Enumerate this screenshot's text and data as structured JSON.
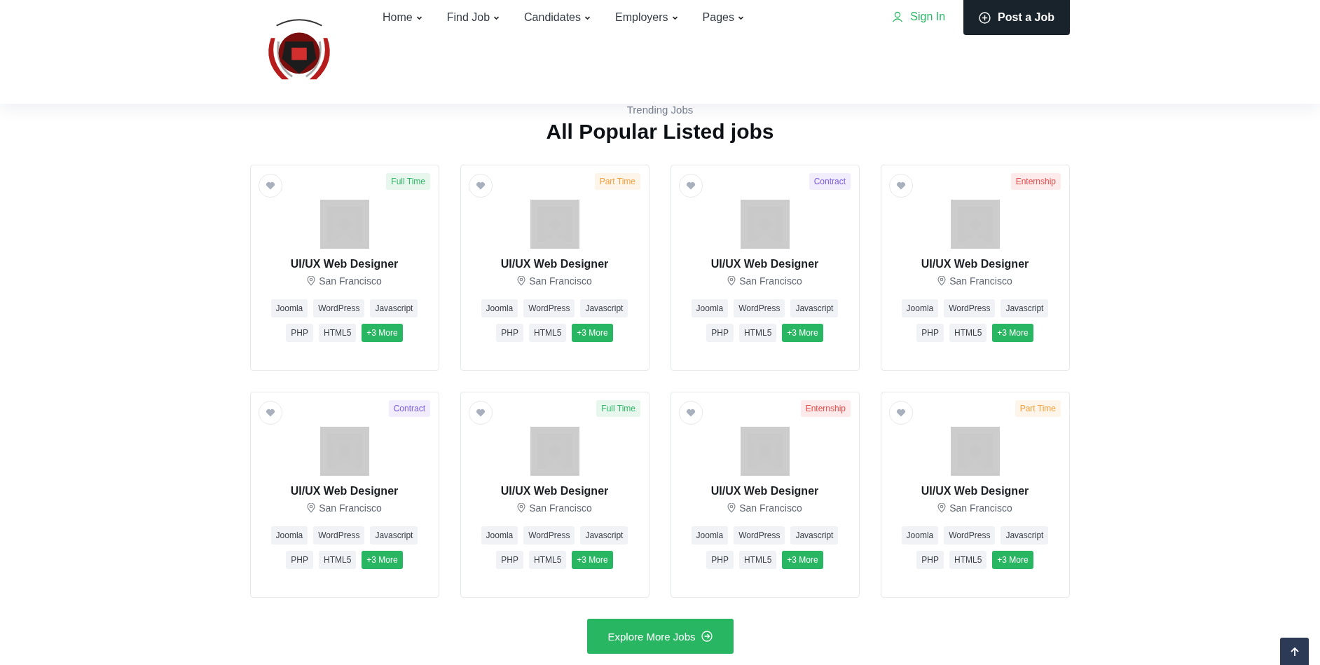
{
  "header": {
    "nav": [
      {
        "label": "Home"
      },
      {
        "label": "Find Job"
      },
      {
        "label": "Candidates"
      },
      {
        "label": "Employers"
      },
      {
        "label": "Pages"
      }
    ],
    "sign_in": "Sign In",
    "post_button": "Post a Job"
  },
  "section": {
    "subtitle": "Trending Jobs",
    "title": "All Popular Listed jobs"
  },
  "jobs": [
    {
      "badge": "Full Time",
      "color": "#2fb866",
      "title": "UI/UX Web Designer",
      "location": "San Francisco",
      "tags": [
        "Joomla",
        "WordPress",
        "Javascript",
        "PHP",
        "HTML5"
      ],
      "more": "+3 More"
    },
    {
      "badge": "Part Time",
      "color": "#f5a03c",
      "title": "UI/UX Web Designer",
      "location": "San Francisco",
      "tags": [
        "Joomla",
        "WordPress",
        "Javascript",
        "PHP",
        "HTML5"
      ],
      "more": "+3 More"
    },
    {
      "badge": "Contract",
      "color": "#7c5ce4",
      "title": "UI/UX Web Designer",
      "location": "San Francisco",
      "tags": [
        "Joomla",
        "WordPress",
        "Javascript",
        "PHP",
        "HTML5"
      ],
      "more": "+3 More"
    },
    {
      "badge": "Enternship",
      "color": "#ea4a4a",
      "title": "UI/UX Web Designer",
      "location": "San Francisco",
      "tags": [
        "Joomla",
        "WordPress",
        "Javascript",
        "PHP",
        "HTML5"
      ],
      "more": "+3 More"
    },
    {
      "badge": "Contract",
      "color": "#7c5ce4",
      "title": "UI/UX Web Designer",
      "location": "San Francisco",
      "tags": [
        "Joomla",
        "WordPress",
        "Javascript",
        "PHP",
        "HTML5"
      ],
      "more": "+3 More"
    },
    {
      "badge": "Full Time",
      "color": "#2fb866",
      "title": "UI/UX Web Designer",
      "location": "San Francisco",
      "tags": [
        "Joomla",
        "WordPress",
        "Javascript",
        "PHP",
        "HTML5"
      ],
      "more": "+3 More"
    },
    {
      "badge": "Enternship",
      "color": "#ea4a4a",
      "title": "UI/UX Web Designer",
      "location": "San Francisco",
      "tags": [
        "Joomla",
        "WordPress",
        "Javascript",
        "PHP",
        "HTML5"
      ],
      "more": "+3 More"
    },
    {
      "badge": "Part Time",
      "color": "#f5a03c",
      "title": "UI/UX Web Designer",
      "location": "San Francisco",
      "tags": [
        "Joomla",
        "WordPress",
        "Javascript",
        "PHP",
        "HTML5"
      ],
      "more": "+3 More"
    }
  ],
  "explore_button": "Explore More Jobs"
}
